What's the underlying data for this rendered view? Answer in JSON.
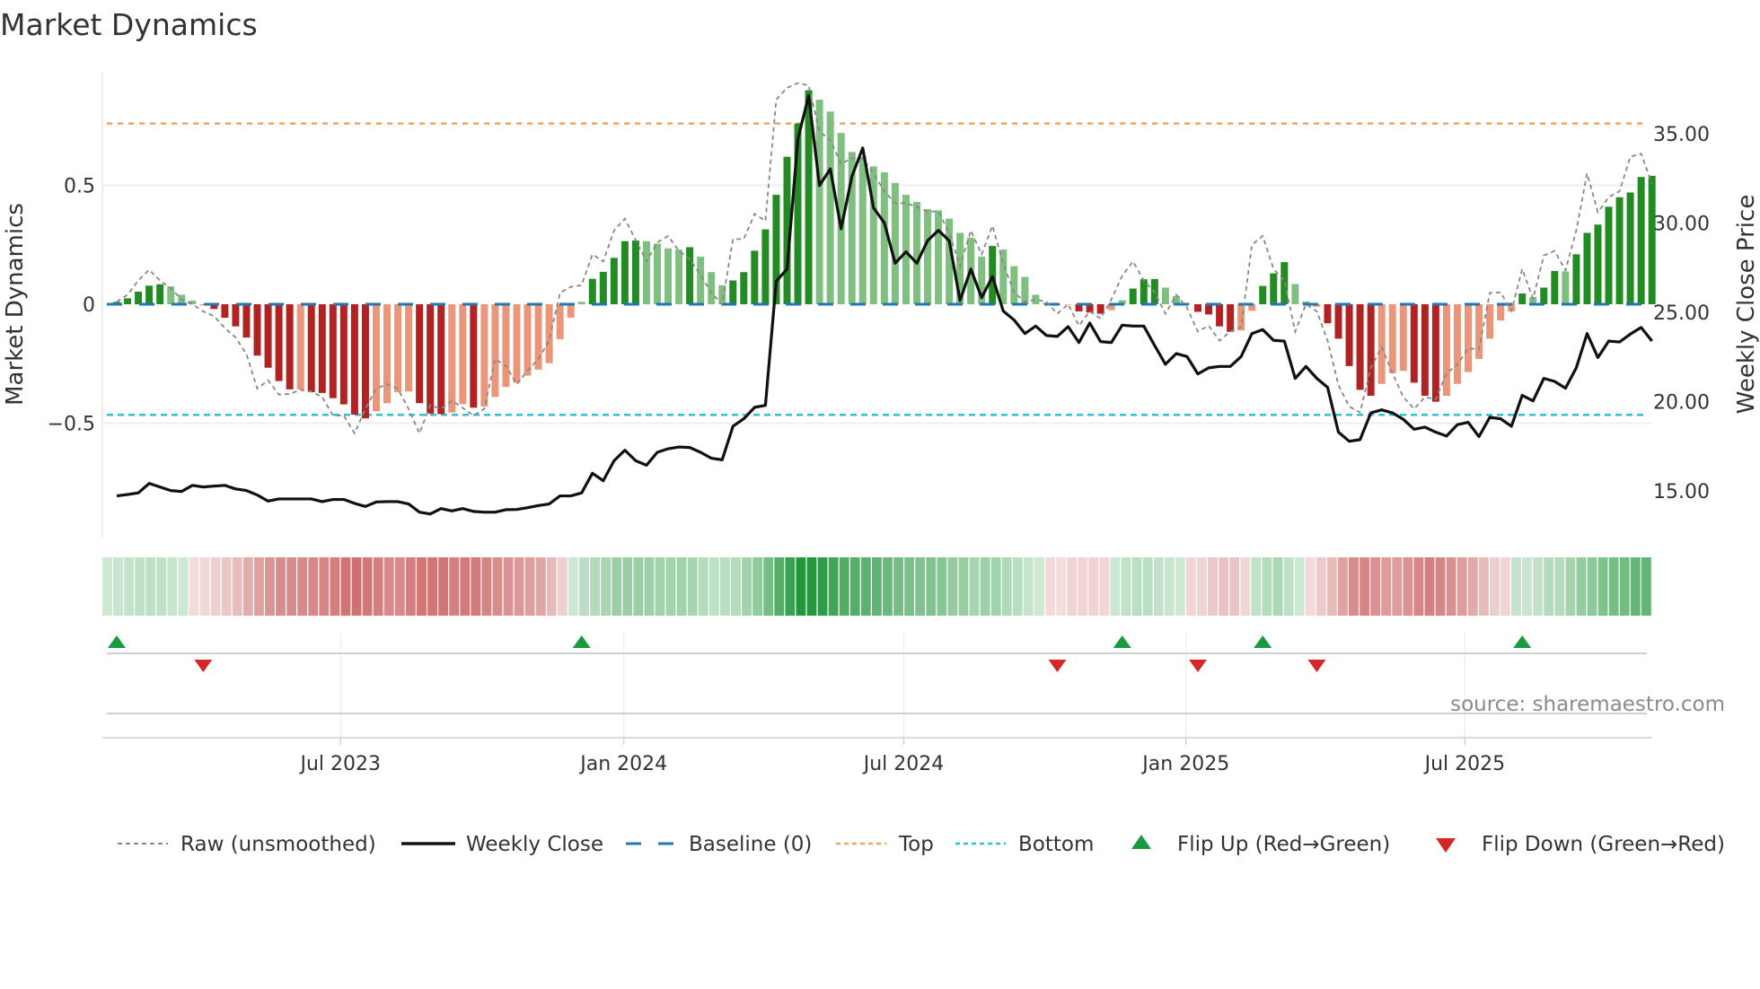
{
  "chart_data": {
    "type": "bar",
    "title": "Market Dynamics",
    "ylabel": "Market Dynamics",
    "ylabel_right": "Weekly Close Price",
    "source": "source: sharemaestro.com",
    "ylim": [
      -0.92,
      0.98
    ],
    "ylim_right": [
      12.5,
      38.9
    ],
    "y_ticks": [
      {
        "value": 0.5,
        "label": "0.5"
      },
      {
        "value": 0,
        "label": "0"
      },
      {
        "value": -0.5,
        "label": "−0.5"
      }
    ],
    "y_ticks_right": [
      {
        "value": 35,
        "label": "35.00"
      },
      {
        "value": 30,
        "label": "30.00"
      },
      {
        "value": 25,
        "label": "25.00"
      },
      {
        "value": 20,
        "label": "20.00"
      },
      {
        "value": 15,
        "label": "15.00"
      }
    ],
    "x_ticks": [
      {
        "week": 20.7,
        "label": "Jul 2023"
      },
      {
        "week": 46.9,
        "label": "Jan 2024"
      },
      {
        "week": 72.8,
        "label": "Jul 2024"
      },
      {
        "week": 98.9,
        "label": "Jan 2025"
      },
      {
        "week": 124.7,
        "label": "Jul 2025"
      }
    ],
    "top_level": 0.76,
    "bottom_level": -0.465,
    "baseline": 0,
    "colors": {
      "up_strong": "#228b22",
      "up_weak": "#7fbf7f",
      "down_strong": "#b22222",
      "down_weak": "#e9967a",
      "baseline": "#1f77b4",
      "top": "#f4a460",
      "bottom": "#26c6da",
      "close": "#111111",
      "raw": "#888888",
      "flip_up": "#1a9a40",
      "flip_down": "#d62728"
    },
    "legend": [
      {
        "label": "Raw (unsmoothed)"
      },
      {
        "label": "Weekly Close"
      },
      {
        "label": "Baseline (0)"
      },
      {
        "label": "Top"
      },
      {
        "label": "Bottom"
      },
      {
        "label": "Flip Up (Red→Green)"
      },
      {
        "label": "Flip Down (Green→Red)"
      }
    ],
    "series": [
      {
        "name": "Market Dynamics",
        "values": [
          0.01,
          0.025,
          0.053,
          0.078,
          0.084,
          0.075,
          0.04,
          0.015,
          -0.005,
          -0.02,
          -0.057,
          -0.093,
          -0.14,
          -0.216,
          -0.267,
          -0.323,
          -0.358,
          -0.358,
          -0.37,
          -0.373,
          -0.395,
          -0.421,
          -0.464,
          -0.48,
          -0.45,
          -0.416,
          -0.37,
          -0.367,
          -0.416,
          -0.46,
          -0.462,
          -0.455,
          -0.42,
          -0.435,
          -0.43,
          -0.39,
          -0.348,
          -0.33,
          -0.3,
          -0.275,
          -0.248,
          -0.147,
          -0.057,
          0.01,
          0.107,
          0.136,
          0.195,
          0.265,
          0.268,
          0.265,
          0.255,
          0.235,
          0.23,
          0.24,
          0.2,
          0.135,
          0.08,
          0.1,
          0.135,
          0.225,
          0.315,
          0.46,
          0.62,
          0.76,
          0.9,
          0.86,
          0.81,
          0.72,
          0.64,
          0.62,
          0.58,
          0.555,
          0.51,
          0.46,
          0.43,
          0.4,
          0.395,
          0.36,
          0.3,
          0.28,
          0.2,
          0.245,
          0.23,
          0.16,
          0.115,
          0.04,
          0.005,
          -0.003,
          -0.002,
          -0.03,
          -0.035,
          -0.04,
          -0.025,
          0.017,
          0.066,
          0.105,
          0.106,
          0.07,
          0.035,
          0.002,
          -0.032,
          -0.043,
          -0.093,
          -0.116,
          -0.11,
          -0.028,
          0.077,
          0.13,
          0.177,
          0.085,
          0.012,
          -0.01,
          -0.08,
          -0.145,
          -0.26,
          -0.36,
          -0.385,
          -0.335,
          -0.29,
          -0.28,
          -0.33,
          -0.385,
          -0.41,
          -0.385,
          -0.335,
          -0.285,
          -0.23,
          -0.145,
          -0.068,
          -0.03,
          0.045,
          0.03,
          0.07,
          0.14,
          0.138,
          0.21,
          0.3,
          0.335,
          0.41,
          0.45,
          0.47,
          0.535,
          0.54
        ]
      },
      {
        "name": "Raw (unsmoothed)",
        "values": [
          0.01,
          0.04,
          0.1,
          0.145,
          0.1,
          0.067,
          0.02,
          0.0,
          -0.03,
          -0.05,
          -0.1,
          -0.14,
          -0.21,
          -0.355,
          -0.32,
          -0.38,
          -0.377,
          -0.36,
          -0.367,
          -0.39,
          -0.468,
          -0.468,
          -0.543,
          -0.44,
          -0.355,
          -0.336,
          -0.355,
          -0.44,
          -0.543,
          -0.424,
          -0.44,
          -0.405,
          -0.436,
          -0.468,
          -0.44,
          -0.23,
          -0.26,
          -0.336,
          -0.28,
          -0.23,
          -0.153,
          0.048,
          0.073,
          0.08,
          0.21,
          0.18,
          0.31,
          0.36,
          0.27,
          0.18,
          0.26,
          0.287,
          0.224,
          0.19,
          0.123,
          0.048,
          0.0,
          0.274,
          0.274,
          0.38,
          0.35,
          0.86,
          0.91,
          0.93,
          0.92,
          0.727,
          0.69,
          0.59,
          0.614,
          0.614,
          0.55,
          0.475,
          0.425,
          0.425,
          0.41,
          0.39,
          0.39,
          0.3,
          0.16,
          0.31,
          0.21,
          0.33,
          0.17,
          0.05,
          0.01,
          0.02,
          0.01,
          -0.04,
          0.0,
          -0.09,
          -0.03,
          -0.06,
          0.02,
          0.12,
          0.18,
          0.1,
          0.05,
          -0.04,
          0.04,
          -0.015,
          -0.115,
          -0.09,
          -0.153,
          -0.115,
          -0.097,
          0.25,
          0.287,
          0.148,
          0.1,
          -0.115,
          0.0,
          -0.03,
          -0.153,
          -0.34,
          -0.43,
          -0.455,
          -0.267,
          -0.18,
          -0.29,
          -0.39,
          -0.44,
          -0.39,
          -0.4,
          -0.29,
          -0.254,
          -0.185,
          -0.19,
          0.048,
          0.05,
          -0.028,
          0.148,
          0.023,
          0.205,
          0.224,
          0.142,
          0.31,
          0.55,
          0.387,
          0.45,
          0.475,
          0.62,
          0.633,
          0.507
        ]
      },
      {
        "name": "Weekly Close",
        "axis": "right",
        "values": [
          14.72,
          14.8,
          14.89,
          15.42,
          15.22,
          15.02,
          14.97,
          15.31,
          15.22,
          15.27,
          15.31,
          15.11,
          15.02,
          14.77,
          14.43,
          14.55,
          14.55,
          14.55,
          14.55,
          14.4,
          14.52,
          14.52,
          14.3,
          14.13,
          14.38,
          14.4,
          14.4,
          14.27,
          13.81,
          13.71,
          14.01,
          13.88,
          14.01,
          13.85,
          13.81,
          13.81,
          13.95,
          13.96,
          14.06,
          14.18,
          14.27,
          14.72,
          14.72,
          14.89,
          15.99,
          15.57,
          16.69,
          17.28,
          16.69,
          16.44,
          17.16,
          17.36,
          17.46,
          17.43,
          17.16,
          16.83,
          16.74,
          18.62,
          19.04,
          19.68,
          19.79,
          26.74,
          27.42,
          34.7,
          37.13,
          32.1,
          33.03,
          29.68,
          32.61,
          34.2,
          30.85,
          30.01,
          27.75,
          28.39,
          27.75,
          29.01,
          29.59,
          29.01,
          25.66,
          27.42,
          25.82,
          27.0,
          25.07,
          24.57,
          23.81,
          24.23,
          23.7,
          23.65,
          24.2,
          23.31,
          24.4,
          23.36,
          23.31,
          24.28,
          24.23,
          24.23,
          23.14,
          22.09,
          22.69,
          22.52,
          21.55,
          21.89,
          21.97,
          21.97,
          22.52,
          23.81,
          24.03,
          23.43,
          23.39,
          21.3,
          21.97,
          21.3,
          20.8,
          18.29,
          17.78,
          17.87,
          19.37,
          19.54,
          19.37,
          19.01,
          18.45,
          18.57,
          18.29,
          18.07,
          18.71,
          18.84,
          18.04,
          19.12,
          19.04,
          18.62,
          20.35,
          20.04,
          21.3,
          21.13,
          20.75,
          21.89,
          23.81,
          22.47,
          23.39,
          23.34,
          23.78,
          24.15,
          23.39
        ]
      }
    ]
  }
}
